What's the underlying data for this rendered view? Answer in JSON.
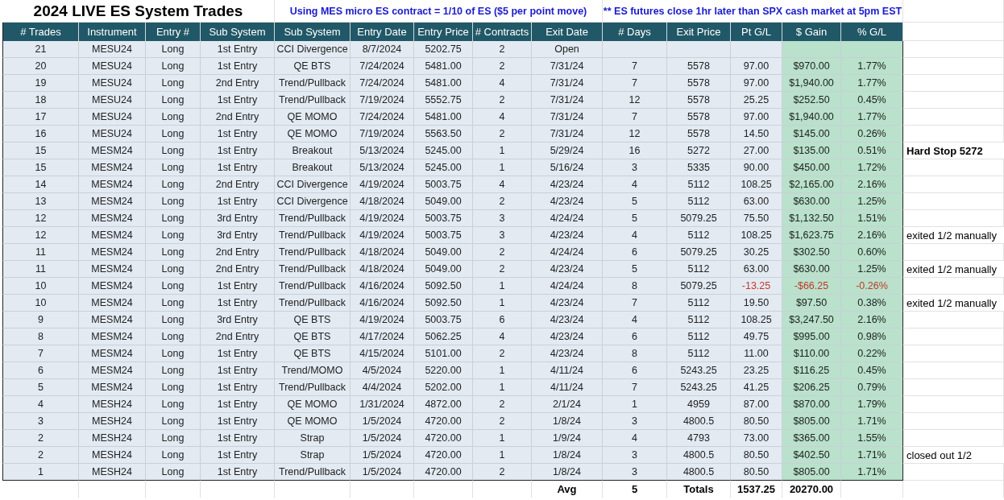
{
  "title": "2024 LIVE ES System Trades",
  "notes": [
    "Using MES micro ES contract = 1/10 of ES ($5 per point move)",
    "** ES futures close 1hr later than SPX cash market at 5pm EST"
  ],
  "columns": [
    {
      "label": "# Trades",
      "shaded": false
    },
    {
      "label": "Instrument",
      "shaded": false
    },
    {
      "label": "Entry #",
      "shaded": false
    },
    {
      "label": "Sub System",
      "shaded": false
    },
    {
      "label": "Sub System",
      "shaded": false
    },
    {
      "label": "Entry Date",
      "shaded": false
    },
    {
      "label": "Entry Price",
      "shaded": false
    },
    {
      "label": "# Contracts",
      "shaded": false
    },
    {
      "label": "Exit Date",
      "shaded": false
    },
    {
      "label": "# Days",
      "shaded": false
    },
    {
      "label": "Exit Price",
      "shaded": false
    },
    {
      "label": "Pt G/L",
      "shaded": false
    },
    {
      "label": "$ Gain",
      "shaded": true
    },
    {
      "label": "% G/L",
      "shaded": true
    }
  ],
  "rows": [
    {
      "cells": [
        "21",
        "MESU24",
        "Long",
        "1st Entry",
        "CCI Divergence",
        "8/7/2024",
        "5202.75",
        "2",
        "Open",
        "",
        "",
        "",
        "",
        ""
      ]
    },
    {
      "cells": [
        "20",
        "MESU24",
        "Long",
        "1st Entry",
        "QE BTS",
        "7/24/2024",
        "5481.00",
        "2",
        "7/31/24",
        "7",
        "5578",
        "97.00",
        "$970.00",
        "1.77%"
      ],
      "loss": false
    },
    {
      "cells": [
        "19",
        "MESU24",
        "Long",
        "2nd Entry",
        "Trend/Pullback",
        "7/24/2024",
        "5481.00",
        "4",
        "7/31/24",
        "7",
        "5578",
        "97.00",
        "$1,940.00",
        "1.77%"
      ],
      "loss": false
    },
    {
      "cells": [
        "18",
        "MESU24",
        "Long",
        "1st Entry",
        "Trend/Pullback",
        "7/19/2024",
        "5552.75",
        "2",
        "7/31/24",
        "12",
        "5578",
        "25.25",
        "$252.50",
        "0.45%"
      ],
      "loss": false
    },
    {
      "cells": [
        "17",
        "MESU24",
        "Long",
        "2nd Entry",
        "QE MOMO",
        "7/24/2024",
        "5481.00",
        "4",
        "7/31/24",
        "7",
        "5578",
        "97.00",
        "$1,940.00",
        "1.77%"
      ],
      "loss": false
    },
    {
      "cells": [
        "16",
        "MESU24",
        "Long",
        "1st Entry",
        "QE MOMO",
        "7/19/2024",
        "5563.50",
        "2",
        "7/31/24",
        "12",
        "5578",
        "14.50",
        "$145.00",
        "0.26%"
      ],
      "loss": false
    },
    {
      "cells": [
        "15",
        "MESM24",
        "Long",
        "1st Entry",
        "Breakout",
        "5/13/2024",
        "5245.00",
        "1",
        "5/29/24",
        "16",
        "5272",
        "27.00",
        "$135.00",
        "0.51%"
      ],
      "loss": false,
      "note": {
        "text": "Hard Stop 5272",
        "kind": "bold"
      }
    },
    {
      "cells": [
        "15",
        "MESM24",
        "Long",
        "1st Entry",
        "Breakout",
        "5/13/2024",
        "5245.00",
        "1",
        "5/16/24",
        "3",
        "5335",
        "90.00",
        "$450.00",
        "1.72%"
      ],
      "loss": false
    },
    {
      "cells": [
        "14",
        "MESM24",
        "Long",
        "2nd Entry",
        "CCI Divergence",
        "4/19/2024",
        "5003.75",
        "4",
        "4/23/24",
        "4",
        "5112",
        "108.25",
        "$2,165.00",
        "2.16%"
      ],
      "loss": false
    },
    {
      "cells": [
        "13",
        "MESM24",
        "Long",
        "1st Entry",
        "CCI Divergence",
        "4/18/2024",
        "5049.00",
        "2",
        "4/23/24",
        "5",
        "5112",
        "63.00",
        "$630.00",
        "1.25%"
      ],
      "loss": false
    },
    {
      "cells": [
        "12",
        "MESM24",
        "Long",
        "3rd Entry",
        "Trend/Pullback",
        "4/19/2024",
        "5003.75",
        "3",
        "4/24/24",
        "5",
        "5079.25",
        "75.50",
        "$1,132.50",
        "1.51%"
      ],
      "loss": false
    },
    {
      "cells": [
        "12",
        "MESM24",
        "Long",
        "3rd Entry",
        "Trend/Pullback",
        "4/19/2024",
        "5003.75",
        "3",
        "4/23/24",
        "4",
        "5112",
        "108.25",
        "$1,623.75",
        "2.16%"
      ],
      "loss": false,
      "note": {
        "text": "exited 1/2 manually",
        "kind": "plain"
      }
    },
    {
      "cells": [
        "11",
        "MESM24",
        "Long",
        "2nd Entry",
        "Trend/Pullback",
        "4/18/2024",
        "5049.00",
        "2",
        "4/24/24",
        "6",
        "5079.25",
        "30.25",
        "$302.50",
        "0.60%"
      ],
      "loss": false
    },
    {
      "cells": [
        "11",
        "MESM24",
        "Long",
        "2nd Entry",
        "Trend/Pullback",
        "4/18/2024",
        "5049.00",
        "2",
        "4/23/24",
        "5",
        "5112",
        "63.00",
        "$630.00",
        "1.25%"
      ],
      "loss": false,
      "note": {
        "text": "exited 1/2 manually",
        "kind": "plain"
      }
    },
    {
      "cells": [
        "10",
        "MESM24",
        "Long",
        "1st Entry",
        "Trend/Pullback",
        "4/16/2024",
        "5092.50",
        "1",
        "4/24/24",
        "8",
        "5079.25",
        "-13.25",
        "-$66.25",
        "-0.26%"
      ],
      "loss": true
    },
    {
      "cells": [
        "10",
        "MESM24",
        "Long",
        "1st Entry",
        "Trend/Pullback",
        "4/16/2024",
        "5092.50",
        "1",
        "4/23/24",
        "7",
        "5112",
        "19.50",
        "$97.50",
        "0.38%"
      ],
      "loss": false,
      "note": {
        "text": "exited 1/2 manually",
        "kind": "plain"
      }
    },
    {
      "cells": [
        "9",
        "MESM24",
        "Long",
        "3rd Entry",
        "QE BTS",
        "4/19/2024",
        "5003.75",
        "6",
        "4/23/24",
        "4",
        "5112",
        "108.25",
        "$3,247.50",
        "2.16%"
      ],
      "loss": false
    },
    {
      "cells": [
        "8",
        "MESM24",
        "Long",
        "2nd Entry",
        "QE BTS",
        "4/17/2024",
        "5062.25",
        "4",
        "4/23/24",
        "6",
        "5112",
        "49.75",
        "$995.00",
        "0.98%"
      ],
      "loss": false
    },
    {
      "cells": [
        "7",
        "MESM24",
        "Long",
        "1st Entry",
        "QE BTS",
        "4/15/2024",
        "5101.00",
        "2",
        "4/23/24",
        "8",
        "5112",
        "11.00",
        "$110.00",
        "0.22%"
      ],
      "loss": false
    },
    {
      "cells": [
        "6",
        "MESM24",
        "Long",
        "1st Entry",
        "Trend/MOMO",
        "4/5/2024",
        "5220.00",
        "1",
        "4/11/24",
        "6",
        "5243.25",
        "23.25",
        "$116.25",
        "0.45%"
      ],
      "loss": false
    },
    {
      "cells": [
        "5",
        "MESM24",
        "Long",
        "1st Entry",
        "Trend/Pullback",
        "4/4/2024",
        "5202.00",
        "1",
        "4/11/24",
        "7",
        "5243.25",
        "41.25",
        "$206.25",
        "0.79%"
      ],
      "loss": false
    },
    {
      "cells": [
        "4",
        "MESH24",
        "Long",
        "1st Entry",
        "QE MOMO",
        "1/31/2024",
        "4872.00",
        "2",
        "2/1/24",
        "1",
        "4959",
        "87.00",
        "$870.00",
        "1.79%"
      ],
      "loss": false
    },
    {
      "cells": [
        "3",
        "MESH24",
        "Long",
        "1st Entry",
        "QE MOMO",
        "1/5/2024",
        "4720.00",
        "2",
        "1/8/24",
        "3",
        "4800.5",
        "80.50",
        "$805.00",
        "1.71%"
      ],
      "loss": false
    },
    {
      "cells": [
        "2",
        "MESH24",
        "Long",
        "1st Entry",
        "Strap",
        "1/5/2024",
        "4720.00",
        "1",
        "1/9/24",
        "4",
        "4793",
        "73.00",
        "$365.00",
        "1.55%"
      ],
      "loss": false
    },
    {
      "cells": [
        "2",
        "MESH24",
        "Long",
        "1st Entry",
        "Strap",
        "1/5/2024",
        "4720.00",
        "1",
        "1/8/24",
        "3",
        "4800.5",
        "80.50",
        "$402.50",
        "1.71%"
      ],
      "loss": false,
      "note": {
        "text": "closed out 1/2",
        "kind": "plain"
      }
    },
    {
      "cells": [
        "1",
        "MESH24",
        "Long",
        "1st Entry",
        "Trend/Pullback",
        "1/5/2024",
        "4720.00",
        "2",
        "1/8/24",
        "3",
        "4800.5",
        "80.50",
        "$805.00",
        "1.71%"
      ],
      "loss": false
    }
  ],
  "footer": {
    "avg_label": "Avg",
    "avg_days": "5",
    "totals_label": "Totals",
    "total_points": "1537.25",
    "total_gain": "20270.00"
  }
}
